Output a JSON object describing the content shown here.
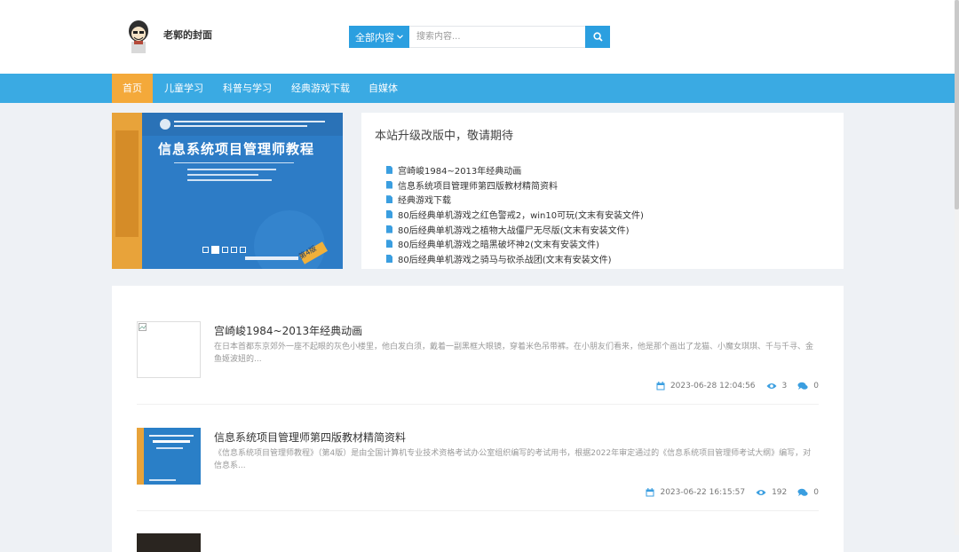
{
  "header": {
    "site_name": "老郭的封面",
    "search": {
      "category_label": "全部内容",
      "placeholder": "搜索内容..."
    }
  },
  "nav": {
    "items": [
      {
        "label": "首页"
      },
      {
        "label": "儿童学习"
      },
      {
        "label": "科普与学习"
      },
      {
        "label": "经典游戏下载"
      },
      {
        "label": "自媒体"
      }
    ]
  },
  "slider": {
    "book": {
      "top_text": "全国计算机技术与软件专业技术资格（水平）考试指定用书",
      "title": "信息系统项目管理师教程",
      "authors": "全国计算机专业技术资格考试办公室 组编",
      "edition": "第4版",
      "publisher": "清华大学出版社",
      "spine": "信息系统项目管理师教程（第4版）"
    },
    "active_dot": 1,
    "dot_count": 5
  },
  "notice": {
    "title": "本站升级改版中，敬请期待",
    "items": [
      "宫崎峻1984~2013年经典动画",
      "信息系统项目管理师第四版教材精简资料",
      "经典游戏下载",
      "80后经典单机游戏之红色警戒2，win10可玩(文末有安装文件)",
      "80后经典单机游戏之植物大战僵尸无尽版(文末有安装文件)",
      "80后经典单机游戏之暗黑破坏神2(文末有安装文件)",
      "80后经典单机游戏之骑马与砍杀战团(文末有安装文件)"
    ]
  },
  "posts": [
    {
      "title": "宫崎峻1984~2013年经典动画",
      "excerpt": "在日本首都东京郊外一座不起眼的灰色小楼里，他白发白须，戴着一副黑框大眼镜，穿着米色吊带裤。在小朋友们看来，他是那个画出了龙猫、小魔女琪琪、千与千寻、金鱼姬波妞的...",
      "date": "2023-06-28 12:04:56",
      "views": "3",
      "comments": "0"
    },
    {
      "title": "信息系统项目管理师第四版教材精简资料",
      "excerpt": "《信息系统项目管理师教程》（第4版）是由全国计算机专业技术资格考试办公室组织编写的考试用书，根据2022年审定通过的《信息系统项目管理师考试大纲》编写，对信息系...",
      "date": "2023-06-22 16:15:57",
      "views": "192",
      "comments": "0"
    }
  ],
  "colors": {
    "primary": "#3aaae3",
    "search_blue": "#2b9fe0",
    "active_nav": "#f4a93a",
    "page_bg": "#eef1f5"
  },
  "icons": {
    "calendar": "calendar-icon",
    "views": "eye-icon",
    "comments": "comments-icon",
    "search": "search-icon",
    "doc": "doc-icon"
  }
}
